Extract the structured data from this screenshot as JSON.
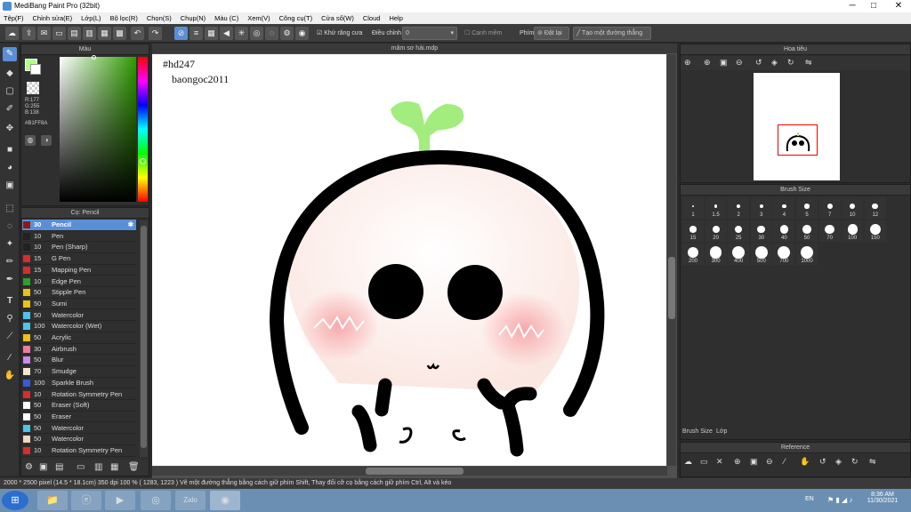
{
  "window": {
    "title": "MediBang Paint Pro (32bit)",
    "minimize": "─",
    "maximize": "□",
    "close": "✕"
  },
  "menu": [
    "Tệp(F)",
    "Chỉnh sửa(E)",
    "Lớp(L)",
    "Bộ lọc(R)",
    "Chọn(S)",
    "Chụp(N)",
    "Màu (C)",
    "Xem(V)",
    "Công cụ(T)",
    "Cửa sổ(W)",
    "Cloud",
    "Help"
  ],
  "toolbar": {
    "antialias": "Khử răng cưa",
    "adjust_label": "Điều chỉnh",
    "adjust_value": "0",
    "edge": "Cạnh mềm",
    "key_label": "Phím",
    "reset": "Đặt lại",
    "straight": "Tạo một đường thẳng"
  },
  "color_panel": {
    "title": "Màu",
    "r": "R:177",
    "g": "G:255",
    "b": "B:138",
    "hex": "#B1FF8A",
    "fg": "#b1ff8a"
  },
  "brush_panel": {
    "title": "Cọ: Pencil",
    "items": [
      {
        "size": "30",
        "name": "Pencil",
        "color": "#8a1a1a",
        "selected": true
      },
      {
        "size": "10",
        "name": "Pen",
        "color": "#222222"
      },
      {
        "size": "10",
        "name": "Pen (Sharp)",
        "color": "#222222"
      },
      {
        "size": "15",
        "name": "G Pen",
        "color": "#d32f2f"
      },
      {
        "size": "15",
        "name": "Mapping Pen",
        "color": "#d32f2f"
      },
      {
        "size": "10",
        "name": "Edge Pen",
        "color": "#2e9e2e"
      },
      {
        "size": "50",
        "name": "Stipple Pen",
        "color": "#e8c21a"
      },
      {
        "size": "50",
        "name": "Sumi",
        "color": "#e8c21a"
      },
      {
        "size": "50",
        "name": "Watercolor",
        "color": "#4fc3e8"
      },
      {
        "size": "100",
        "name": "Watercolor (Wet)",
        "color": "#4fc3e8"
      },
      {
        "size": "50",
        "name": "Acrylic",
        "color": "#e8c21a"
      },
      {
        "size": "30",
        "name": "Airbrush",
        "color": "#e87fa0"
      },
      {
        "size": "50",
        "name": "Blur",
        "color": "#c78be8"
      },
      {
        "size": "70",
        "name": "Smudge",
        "color": "#f0e8d0"
      },
      {
        "size": "100",
        "name": "Sparkle Brush",
        "color": "#3a5ad0"
      },
      {
        "size": "10",
        "name": "Rotation Symmetry Pen",
        "color": "#d32f2f"
      },
      {
        "size": "50",
        "name": "Eraser (Soft)",
        "color": "#ffffff"
      },
      {
        "size": "50",
        "name": "Eraser",
        "color": "#ffffff"
      },
      {
        "size": "50",
        "name": "Watercolor",
        "color": "#4fc3e8"
      },
      {
        "size": "50",
        "name": "Watercolor",
        "color": "#f0d8c0"
      },
      {
        "size": "10",
        "name": "Rotation Symmetry Pen",
        "color": "#d32f2f"
      }
    ]
  },
  "canvas": {
    "tab": "mâm sơ hải.mdp",
    "text1": "#hd247",
    "text2": "baongoc2011"
  },
  "navigator": {
    "title": "Hoa tiêu"
  },
  "brush_size": {
    "title": "Brush Size",
    "sizes": [
      "1",
      "1.5",
      "2",
      "3",
      "4",
      "5",
      "7",
      "10",
      "12",
      "15",
      "20",
      "25",
      "30",
      "40",
      "50",
      "70",
      "100",
      "150",
      "200",
      "300",
      "400",
      "500",
      "700",
      "1000"
    ],
    "tab1": "Brush Size",
    "tab2": "Lớp"
  },
  "reference": {
    "title": "Reference"
  },
  "status": "2000 * 2500 pixel  (14.5 * 18.1cm)  350 dpi  100 %  ( 1283, 1223 )  Vẽ một đường thẳng bằng cách giữ phím Shift, Thay đổi cỡ cọ bằng cách giữ phím Ctrl, Alt và kéo",
  "taskbar": {
    "lang": "EN",
    "time": "8:36 AM",
    "date": "11/30/2021",
    "zalo": "Zalo"
  }
}
